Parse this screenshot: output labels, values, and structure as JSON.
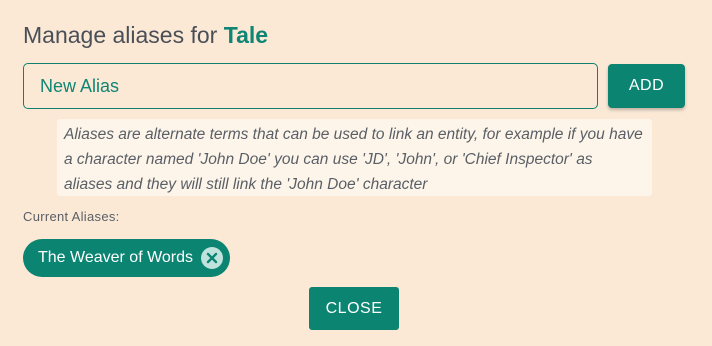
{
  "dialog": {
    "title_prefix": "Manage aliases for",
    "entity_name": "Tale"
  },
  "alias_input": {
    "placeholder": "New Alias",
    "value": ""
  },
  "add_button": {
    "label": "ADD"
  },
  "help_text": "Aliases are alternate terms that can be used to link an entity, for example if you have a character named 'John Doe' you can use 'JD', 'John', or 'Chief Inspector' as aliases and they will still link the 'John Doe' character",
  "current_aliases": {
    "label": "Current Aliases:",
    "items": [
      {
        "label": "The Weaver of Words",
        "remove_icon": "close-circle-icon"
      }
    ]
  },
  "close_button": {
    "label": "CLOSE"
  },
  "colors": {
    "background": "#fbe9d6",
    "accent": "#0b8472",
    "help_background": "#fdf5ea",
    "text": "#4a4f57"
  }
}
